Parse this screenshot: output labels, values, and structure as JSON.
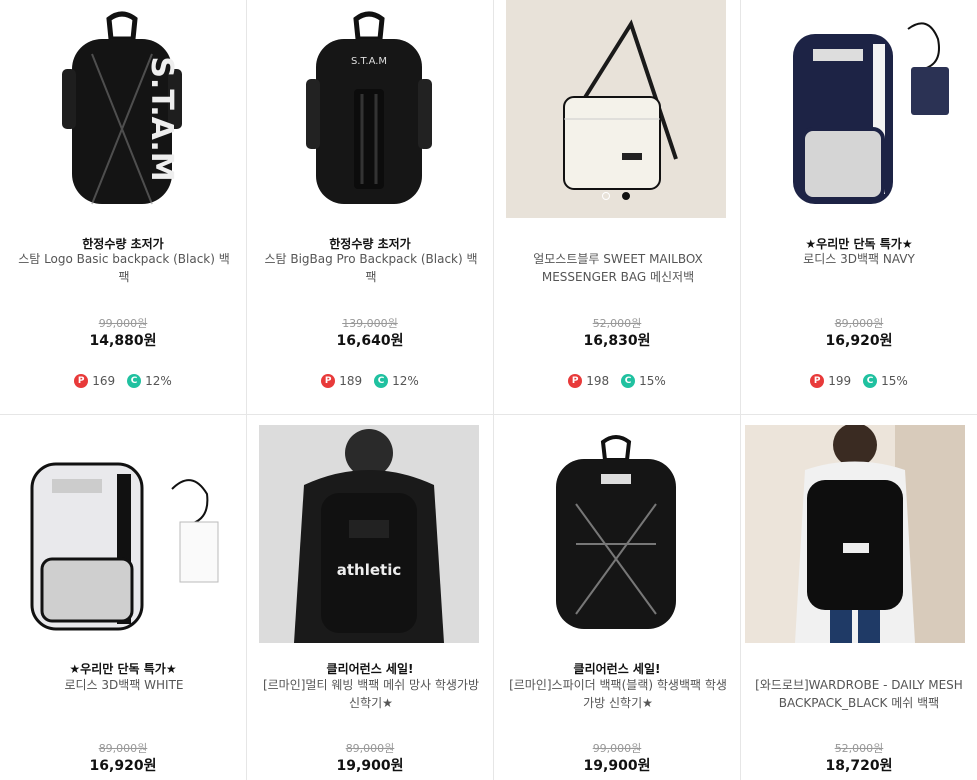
{
  "colors": {
    "point_badge": "#e83a3a",
    "coupon_badge": "#20c1a0"
  },
  "products": [
    {
      "promo": "한정수량 초저가",
      "name": "스탐 Logo Basic backpack (Black) 백팩",
      "original_price": "99,000원",
      "price": "14,880원",
      "points": "169",
      "coupon": "12%",
      "image": "black-stam-backpack"
    },
    {
      "promo": "한정수량 초저가",
      "name": "스탐 BigBag Pro Backpack (Black) 백팩",
      "original_price": "139,000원",
      "price": "16,640원",
      "points": "189",
      "coupon": "12%",
      "image": "black-stam-bigbag"
    },
    {
      "promo": "",
      "name": "얼모스트블루 SWEET MAILBOX MESSENGER BAG 메신저백",
      "original_price": "52,000원",
      "price": "16,830원",
      "points": "198",
      "coupon": "15%",
      "image": "cream-messenger-bag"
    },
    {
      "promo": "★우리만 단독 특가★",
      "name": "로디스 3D백팩 NAVY",
      "original_price": "89,000원",
      "price": "16,920원",
      "points": "199",
      "coupon": "15%",
      "image": "navy-3d-backpack"
    },
    {
      "promo": "★우리만 단독 특가★",
      "name": "로디스 3D백팩 WHITE",
      "original_price": "89,000원",
      "price": "16,920원",
      "image": "white-3d-backpack"
    },
    {
      "promo": "클리어런스 세일!",
      "name": "[르마인]멀티 웨빙 백팩 메쉬 망사 학생가방 신학기★",
      "original_price": "89,000원",
      "price": "19,900원",
      "image": "athletic-backpack-model"
    },
    {
      "promo": "클리어런스 세일!",
      "name": "[르마인]스파이더 백팩(블랙) 학생백팩 학생가방 신학기★",
      "original_price": "99,000원",
      "price": "19,900원",
      "image": "black-spider-backpack"
    },
    {
      "promo": "",
      "name": "[와드로브]WARDROBE - DAILY MESH BACKPACK_BLACK 메쉬 백팩",
      "original_price": "52,000원",
      "price": "18,720원",
      "image": "black-mesh-backpack-model"
    }
  ],
  "badges": {
    "points_symbol": "P",
    "coupon_symbol": "C"
  }
}
